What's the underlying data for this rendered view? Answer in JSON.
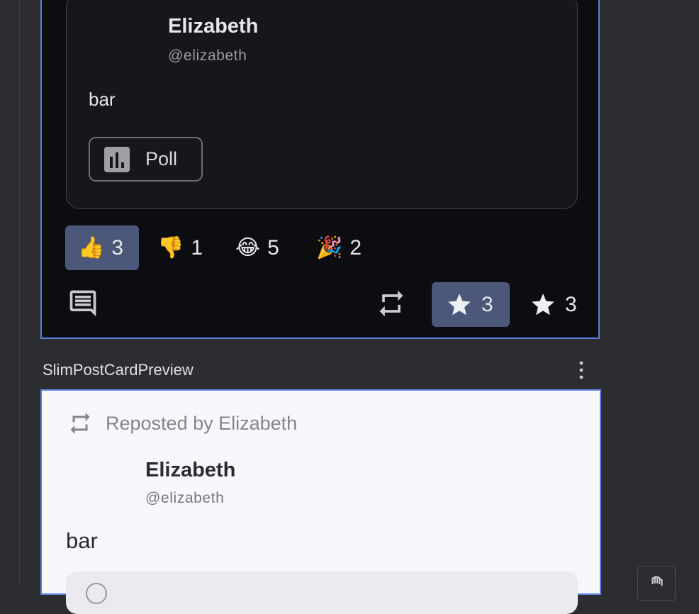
{
  "dark_preview": {
    "author": {
      "name": "Elizabeth",
      "handle": "@elizabeth"
    },
    "body": "bar",
    "poll_label": "Poll",
    "reactions": [
      {
        "emoji": "👍",
        "count": "3",
        "active": true
      },
      {
        "emoji": "👎",
        "count": "1",
        "active": false
      },
      {
        "emoji": "😂",
        "count": "5",
        "active": false
      },
      {
        "emoji": "🎉",
        "count": "2",
        "active": false
      }
    ],
    "actions": {
      "reply_icon": "comment-icon",
      "repost_icon": "repost-icon",
      "favorite_count": "3",
      "favorite_active": true,
      "bookmark_count": "3"
    }
  },
  "preview_label": "SlimPostCardPreview",
  "light_preview": {
    "repost_label": "Reposted by Elizabeth",
    "author": {
      "name": "Elizabeth",
      "handle": "@elizabeth"
    },
    "body": "bar"
  },
  "colors": {
    "selection_border": "#5c7fe0",
    "active_chip": "#4b5879",
    "dark_bg": "#0c0d10",
    "light_bg": "#f8f7fc"
  }
}
